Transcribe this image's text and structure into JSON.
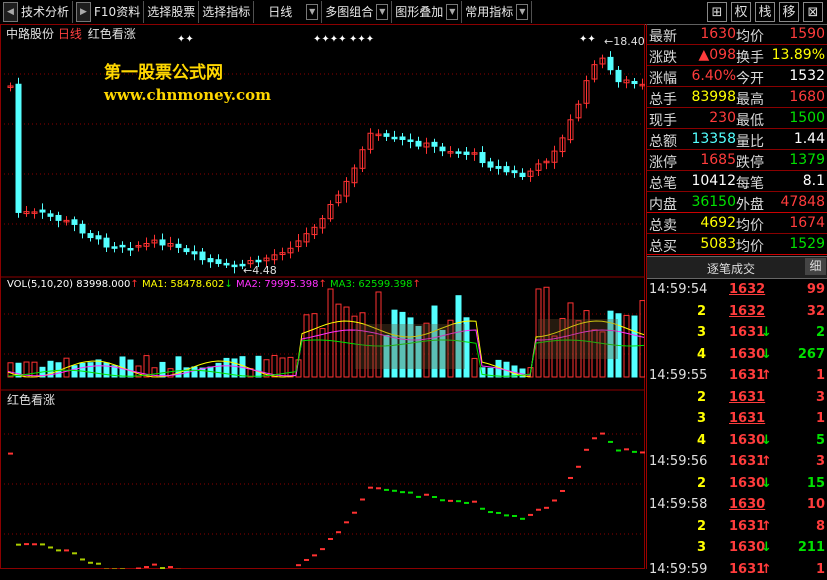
{
  "toolbar": {
    "items": [
      "技术分析",
      "F10资料",
      "选择股票",
      "选择指标",
      "日线",
      "多图组合",
      "图形叠加",
      "常用指标"
    ],
    "right_buttons": [
      "权",
      "栈",
      "移"
    ]
  },
  "header": {
    "stock_name": "中路股份",
    "period": "日线",
    "indicator": "红色看涨"
  },
  "watermark": {
    "line1": "第一股票公式网",
    "line2": "www.chnmoney.com"
  },
  "price_panel": {
    "high_label": "18.40",
    "low_label": "4.48",
    "markers": [
      "✦✦",
      "✦✦✦✦",
      "✦✦✦",
      "✦✦"
    ]
  },
  "vol_panel": {
    "label": "VOL(5,10,20)",
    "value": "83998.000",
    "arrow": "↑",
    "ma1_label": "MA1:",
    "ma1": "58478.602",
    "ma1_arrow": "↓",
    "ma2_label": "MA2:",
    "ma2": "79995.398",
    "ma2_arrow": "↑",
    "ma3_label": "MA3:",
    "ma3": "62599.398",
    "ma3_arrow": "↑"
  },
  "indicator_panel": {
    "label": "红色看涨"
  },
  "quote": [
    {
      "l1": "最新",
      "v1": "1630",
      "l2": "均价",
      "v2": "1590"
    },
    {
      "l1": "涨跌",
      "v1": "▲098",
      "l2": "换手",
      "v2": "13.89%"
    },
    {
      "l1": "涨幅",
      "v1": "6.40%",
      "l2": "今开",
      "v2": "1532"
    },
    {
      "l1": "总手",
      "v1": "83998",
      "l2": "最高",
      "v2": "1680"
    },
    {
      "l1": "现手",
      "v1": "230",
      "l2": "最低",
      "v2": "1500"
    },
    {
      "l1": "总额",
      "v1": "13358",
      "l2": "量比",
      "v2": "1.44"
    },
    {
      "l1": "涨停",
      "v1": "1685",
      "l2": "跌停",
      "v2": "1379"
    },
    {
      "l1": "总笔",
      "v1": "10412",
      "l2": "每笔",
      "v2": "8.1"
    },
    {
      "l1": "内盘",
      "v1": "36150",
      "l2": "外盘",
      "v2": "47848"
    },
    {
      "l1": "总卖",
      "v1": "4692",
      "l2": "均价",
      "v2": "1674"
    },
    {
      "l1": "总买",
      "v1": "5083",
      "l2": "均价",
      "v2": "1529"
    }
  ],
  "trades_tab": {
    "title": "逐笔成交",
    "tab": "细"
  },
  "trades": [
    {
      "time": "14:59:54",
      "n": "",
      "price": "1632",
      "dir": "",
      "vol": "99"
    },
    {
      "time": "",
      "n": "2",
      "price": "1632",
      "dir": "",
      "vol": "32"
    },
    {
      "time": "",
      "n": "3",
      "price": "1631",
      "dir": "↓",
      "vol": "2"
    },
    {
      "time": "",
      "n": "4",
      "price": "1630",
      "dir": "↓",
      "vol": "267"
    },
    {
      "time": "14:59:55",
      "n": "",
      "price": "1631",
      "dir": "↑",
      "vol": "1"
    },
    {
      "time": "",
      "n": "2",
      "price": "1631",
      "dir": "",
      "vol": "3"
    },
    {
      "time": "",
      "n": "3",
      "price": "1631",
      "dir": "",
      "vol": "1"
    },
    {
      "time": "",
      "n": "4",
      "price": "1630",
      "dir": "↓",
      "vol": "5"
    },
    {
      "time": "14:59:56",
      "n": "",
      "price": "1631",
      "dir": "↑",
      "vol": "3"
    },
    {
      "time": "",
      "n": "2",
      "price": "1630",
      "dir": "↓",
      "vol": "15"
    },
    {
      "time": "14:59:58",
      "n": "",
      "price": "1630",
      "dir": "",
      "vol": "10"
    },
    {
      "time": "",
      "n": "2",
      "price": "1631",
      "dir": "↑",
      "vol": "8"
    },
    {
      "time": "",
      "n": "3",
      "price": "1630",
      "dir": "↓",
      "vol": "211"
    },
    {
      "time": "14:59:59",
      "n": "",
      "price": "1631",
      "dir": "↑",
      "vol": "1"
    }
  ],
  "colors": {
    "up": "#ff3232",
    "down": "#54ffff",
    "label_red": "#ff3c3c",
    "yellow": "#ffff00",
    "green": "#00e000",
    "ma1": "#ffff00",
    "ma2": "#ff30ff",
    "ma3": "#00e000",
    "grid": "#8b0000",
    "white": "#ffffff"
  }
}
